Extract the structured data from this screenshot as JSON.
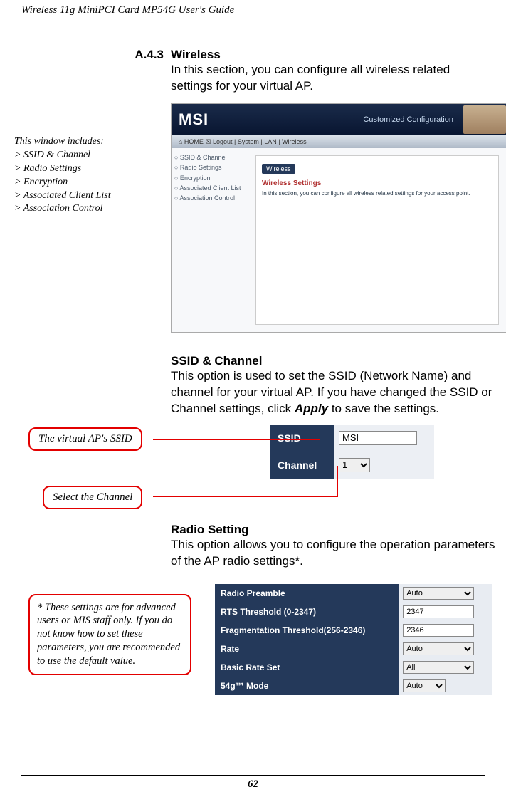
{
  "header": "Wireless 11g MiniPCI Card MP54G User's Guide",
  "section": {
    "num": "A.4.3",
    "title": "Wireless",
    "body": "In this section, you can configure all wireless related settings for your virtual AP."
  },
  "leftnote": {
    "title": "This window includes:",
    "items": [
      "> SSID & Channel",
      "> Radio Settings",
      "> Encryption",
      "> Associated Client List",
      "> Association Control"
    ]
  },
  "shot1": {
    "logo": "MSI",
    "conf": "Customized Configuration",
    "menurow": "⌂ HOME  ☒ Logout   |   System   |   LAN   |   Wireless",
    "side": [
      "○  SSID & Channel",
      "○  Radio Settings",
      "○  Encryption",
      "○  Associated Client List",
      "○  Association Control"
    ],
    "inner_tag": "Wireless",
    "inner_sub": "Wireless Settings",
    "inner_desc": "In this section, you can configure all wireless related settings for your access point."
  },
  "ssid": {
    "heading": "SSID & Channel",
    "body_pre": "This option is used to set the SSID (Network Name) and channel for your virtual AP.  If you have changed the SSID or Channel settings, click ",
    "body_bold": "Apply",
    "body_post": " to save the settings."
  },
  "callouts": {
    "ssid": "The virtual AP's SSID",
    "chan": "Select the Channel"
  },
  "ssidwidget": {
    "label1": "SSID",
    "value1": "MSI",
    "label2": "Channel",
    "value2": "1"
  },
  "radio": {
    "heading": "Radio Setting",
    "body": "This option allows you to configure the operation parameters of the AP radio settings*."
  },
  "notebox": "* These settings are for advanced users or MIS staff only.  If you do not know how to set these parameters, you are recommended to use the default value.",
  "radiotable": {
    "rows": [
      {
        "label": "Radio Preamble",
        "type": "select",
        "value": "Auto"
      },
      {
        "label": "RTS Threshold (0-2347)",
        "type": "input",
        "value": "2347"
      },
      {
        "label": "Fragmentation Threshold(256-2346)",
        "type": "input",
        "value": "2346"
      },
      {
        "label": "Rate",
        "type": "select",
        "value": "Auto"
      },
      {
        "label": "Basic Rate Set",
        "type": "select",
        "value": "All"
      },
      {
        "label": "54g™ Mode",
        "type": "select-narrow",
        "value": "Auto"
      }
    ]
  },
  "pagenum": "62"
}
